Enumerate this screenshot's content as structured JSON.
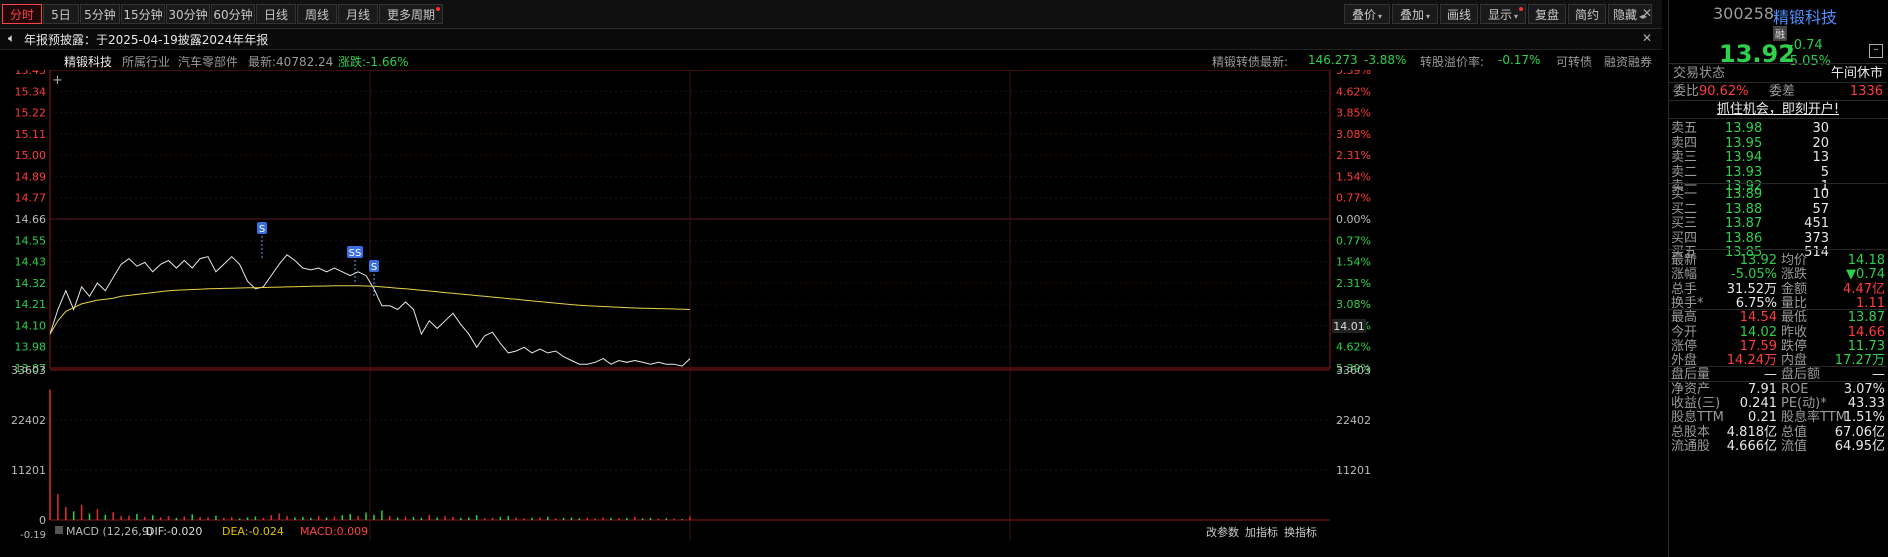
{
  "toolbar": {
    "left": [
      "分时",
      "5日",
      "5分钟",
      "15分钟",
      "30分钟",
      "60分钟",
      "日线",
      "周线",
      "月线",
      "更多周期"
    ],
    "right": [
      "叠价",
      "叠加",
      "画线",
      "显示",
      "复盘",
      "简约",
      "隐藏"
    ]
  },
  "notice": "年报预披露：于2025-04-19披露2024年年报",
  "info": {
    "name": "精锻科技",
    "industry_label": "所属行业",
    "industry": "汽车零部件",
    "latest": "最新:40782.24",
    "change": "涨跌:-1.66%",
    "bond_latest_label": "精锻转债最新:",
    "bond_latest": "146.273",
    "bond_change": "-3.88%",
    "premium_label": "转股溢价率:",
    "premium": "-0.17%",
    "convertible": "可转债",
    "margin": "融资融券"
  },
  "yaxis_left": [
    "15.45",
    "15.34",
    "15.22",
    "15.11",
    "15.00",
    "14.89",
    "14.77",
    "14.66",
    "14.55",
    "14.43",
    "14.32",
    "14.21",
    "14.10",
    "13.98",
    "13.87"
  ],
  "yaxis_right": [
    "5.39%",
    "4.62%",
    "3.85%",
    "3.08%",
    "2.31%",
    "1.54%",
    "0.77%",
    "0.00%",
    "0.77%",
    "1.54%",
    "2.31%",
    "3.08%",
    "3.85%",
    "4.62%",
    "5.39%"
  ],
  "price_tag": "14.01",
  "vol_axis": [
    "33603",
    "22402",
    "11201",
    "0"
  ],
  "vol_axis_right": [
    "33603",
    "22402",
    "11201"
  ],
  "macd": {
    "label": "MACD (12,26,9)",
    "dif": "DIF:-0.020",
    "dea": "DEA:-0.024",
    "macd": "MACD:0.009",
    "min": "-0.19"
  },
  "bottom_links": [
    "改参数",
    "加指标",
    "换指标"
  ],
  "chart_data": {
    "type": "line",
    "ylim": [
      13.87,
      15.45
    ],
    "prev_close": 14.66,
    "series": [
      {
        "name": "price",
        "values": [
          14.05,
          14.18,
          14.28,
          14.18,
          14.3,
          14.25,
          14.32,
          14.28,
          14.35,
          14.42,
          14.45,
          14.41,
          14.43,
          14.38,
          14.42,
          14.44,
          14.4,
          14.44,
          14.4,
          14.45,
          14.46,
          14.38,
          14.42,
          14.46,
          14.42,
          14.33,
          14.29,
          14.3,
          14.36,
          14.42,
          14.47,
          14.44,
          14.4,
          14.39,
          14.4,
          14.38,
          14.4,
          14.38,
          14.36,
          14.38,
          14.36,
          14.29,
          14.2,
          14.2,
          14.18,
          14.22,
          14.18,
          14.05,
          14.12,
          14.08,
          14.12,
          14.16,
          14.1,
          14.05,
          13.98,
          14.04,
          14.06,
          14.0,
          13.95,
          13.96,
          13.98,
          13.95,
          13.97,
          13.95,
          13.96,
          13.93,
          13.91,
          13.89,
          13.89,
          13.9,
          13.92,
          13.89,
          13.91,
          13.9,
          13.91,
          13.9,
          13.89,
          13.9,
          13.89,
          13.89,
          13.88,
          13.92
        ]
      },
      {
        "name": "avg",
        "values": [
          14.05,
          14.12,
          14.17,
          14.19,
          14.21,
          14.22,
          14.23,
          14.235,
          14.24,
          14.25,
          14.255,
          14.26,
          14.265,
          14.27,
          14.275,
          14.28,
          14.282,
          14.284,
          14.286,
          14.288,
          14.29,
          14.291,
          14.292,
          14.293,
          14.294,
          14.295,
          14.296,
          14.297,
          14.298,
          14.299,
          14.3,
          14.301,
          14.302,
          14.303,
          14.304,
          14.305,
          14.306,
          14.306,
          14.306,
          14.306,
          14.305,
          14.303,
          14.3,
          14.297,
          14.293,
          14.29,
          14.286,
          14.282,
          14.278,
          14.274,
          14.27,
          14.266,
          14.262,
          14.258,
          14.254,
          14.25,
          14.246,
          14.242,
          14.238,
          14.234,
          14.23,
          14.226,
          14.222,
          14.218,
          14.214,
          14.21,
          14.206,
          14.203,
          14.2,
          14.198,
          14.196,
          14.194,
          14.192,
          14.19,
          14.188,
          14.187,
          14.186,
          14.185,
          14.184,
          14.183,
          14.182,
          14.18
        ]
      }
    ],
    "markers": [
      "S",
      "SS",
      "S"
    ],
    "volume": [
      30000,
      6000,
      3000,
      2000,
      3500,
      1500,
      2500,
      1200,
      1800,
      900,
      1000,
      1400,
      700,
      1100,
      600,
      900,
      500,
      800,
      1300,
      700,
      600,
      1000,
      500,
      700,
      400,
      600,
      800,
      500,
      1100,
      1500,
      900,
      600,
      700,
      500,
      900,
      600,
      800,
      1100,
      1400,
      900,
      1700,
      1200,
      2200,
      900,
      600,
      800,
      700,
      500,
      1200,
      600,
      900,
      700,
      500,
      600,
      1100,
      400,
      500,
      700,
      900,
      600,
      400,
      500,
      600,
      700,
      400,
      500,
      600,
      400,
      500,
      400,
      600,
      500,
      400,
      500,
      700,
      400,
      500,
      300,
      400,
      300,
      200,
      800
    ]
  },
  "right_panel": {
    "code": "300258",
    "name": "精锻科技",
    "badge": "融",
    "price": "13.92",
    "chg": "-0.74",
    "pct": "-5.05%",
    "status_label": "交易状态",
    "status": "午间休市",
    "ratio_label": "委比",
    "ratio": "90.62%",
    "diff_label": "委差",
    "diff": "1336",
    "promo": "抓住机会，即刻开户!",
    "sells": [
      [
        "卖五",
        "13.98",
        "30"
      ],
      [
        "卖四",
        "13.95",
        "20"
      ],
      [
        "卖三",
        "13.94",
        "13"
      ],
      [
        "卖二",
        "13.93",
        "5"
      ],
      [
        "卖一",
        "13.92",
        "1"
      ]
    ],
    "buys": [
      [
        "买一",
        "13.89",
        "10"
      ],
      [
        "买二",
        "13.88",
        "57"
      ],
      [
        "买三",
        "13.87",
        "451"
      ],
      [
        "买四",
        "13.86",
        "373"
      ],
      [
        "买五",
        "13.85",
        "514"
      ]
    ],
    "stats": [
      [
        "最新",
        "13.92",
        "均价",
        "14.18"
      ],
      [
        "涨幅",
        "-5.05%",
        "涨跌",
        "▼0.74"
      ],
      [
        "总手",
        "31.52万",
        "金额",
        "4.47亿"
      ],
      [
        "换手*",
        "6.75%",
        "量比",
        "1.11"
      ],
      [
        "最高",
        "14.54",
        "最低",
        "13.87"
      ],
      [
        "今开",
        "14.02",
        "昨收",
        "14.66"
      ],
      [
        "涨停",
        "17.59",
        "跌停",
        "11.73"
      ],
      [
        "外盘",
        "14.24万",
        "内盘",
        "17.27万"
      ],
      [
        "盘后量",
        "—",
        "盘后额",
        "—"
      ],
      [
        "净资产",
        "7.91",
        "ROE",
        "3.07%"
      ],
      [
        "收益(三)",
        "0.241",
        "PE(动)*",
        "43.33"
      ],
      [
        "股息TTM",
        "0.21",
        "股息率TTM",
        "1.51%"
      ],
      [
        "总股本",
        "4.818亿",
        "总值",
        "67.06亿"
      ],
      [
        "流通股",
        "4.666亿",
        "流值",
        "64.95亿"
      ]
    ]
  }
}
